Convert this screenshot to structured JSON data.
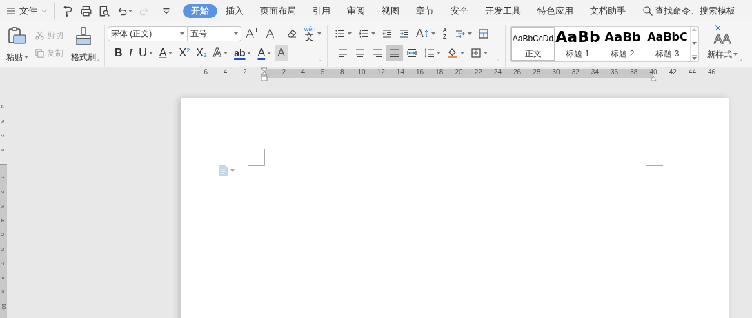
{
  "menu": {
    "label": "文件"
  },
  "quick_access": [
    {
      "kind": "hook",
      "disabled": false
    },
    {
      "kind": "print",
      "disabled": false
    },
    {
      "kind": "preview",
      "disabled": false
    },
    {
      "kind": "undo",
      "disabled": false
    },
    {
      "kind": "redo",
      "disabled": true
    },
    {
      "kind": "customize",
      "disabled": false
    }
  ],
  "tabs": [
    {
      "label": "开始",
      "selected": true
    },
    {
      "label": "插入",
      "selected": false
    },
    {
      "label": "页面布局",
      "selected": false
    },
    {
      "label": "引用",
      "selected": false
    },
    {
      "label": "审阅",
      "selected": false
    },
    {
      "label": "视图",
      "selected": false
    },
    {
      "label": "章节",
      "selected": false
    },
    {
      "label": "安全",
      "selected": false
    },
    {
      "label": "开发工具",
      "selected": false
    },
    {
      "label": "特色应用",
      "selected": false
    },
    {
      "label": "文档助手",
      "selected": false
    }
  ],
  "search": {
    "placeholder": "查找命令、搜索模板"
  },
  "clipboard": {
    "paste": {
      "label": "粘贴"
    },
    "cut": {
      "label": "剪切",
      "disabled": true
    },
    "copy": {
      "label": "复制",
      "disabled": true
    },
    "format_painter": {
      "label": "格式刷"
    }
  },
  "font": {
    "family": "宋体 (正文)",
    "size": "五号"
  },
  "font_tools_row1": [
    {
      "kind": "grow",
      "glyph": "A",
      "dropdown": false
    },
    {
      "kind": "shrink",
      "glyph": "A",
      "dropdown": false
    },
    {
      "kind": "clear",
      "dropdown": false
    },
    {
      "kind": "phonetic",
      "glyph": "文",
      "ruby": "wén",
      "dropdown": true
    }
  ],
  "font_tools_row2": [
    {
      "kind": "bold",
      "glyph": "B",
      "dropdown": false
    },
    {
      "kind": "italic",
      "glyph": "I",
      "dropdown": false
    },
    {
      "kind": "underline",
      "glyph": "U",
      "dropdown": true
    },
    {
      "kind": "strikethrough",
      "glyph": "A",
      "dropdown": true
    },
    {
      "kind": "superscript",
      "glyph": "X",
      "sub": "2",
      "dropdown": false
    },
    {
      "kind": "subscript",
      "glyph": "X",
      "sub": "2",
      "dropdown": false
    },
    {
      "kind": "effect",
      "glyph": "A",
      "dropdown": true
    },
    {
      "kind": "highlight",
      "glyph": "ab",
      "dropdown": true
    },
    {
      "kind": "color",
      "glyph": "A",
      "dropdown": true
    },
    {
      "kind": "shading",
      "glyph": "A",
      "dropdown": false
    }
  ],
  "paragraph_tools_row1": [
    {
      "kind": "bullets",
      "dropdown": true
    },
    {
      "kind": "numbering",
      "dropdown": true
    },
    {
      "kind": "outdent",
      "dropdown": false
    },
    {
      "kind": "indent",
      "dropdown": false
    },
    {
      "kind": "layout",
      "glyph": "A",
      "dropdown": true
    },
    {
      "kind": "sort",
      "glyph": "AZ",
      "dropdown": false
    },
    {
      "kind": "spacing",
      "dropdown": true
    },
    {
      "kind": "table",
      "dropdown": false
    }
  ],
  "paragraph_alignment": [
    {
      "kind": "left",
      "selected": false
    },
    {
      "kind": "center",
      "selected": false
    },
    {
      "kind": "right",
      "selected": false
    },
    {
      "kind": "justify",
      "selected": true
    },
    {
      "kind": "distributed",
      "selected": false
    }
  ],
  "paragraph_tools_row2": [
    {
      "kind": "line_spacing",
      "dropdown": true
    },
    {
      "kind": "fill",
      "dropdown": true
    },
    {
      "kind": "borders",
      "dropdown": true
    }
  ],
  "styles": [
    {
      "kind": "normal",
      "preview": "AaBbCcDd",
      "label": "正文",
      "selected": true
    },
    {
      "kind": "heading1",
      "preview": "AaBb",
      "label": "标题 1",
      "selected": false
    },
    {
      "kind": "heading2",
      "preview": "AaBb",
      "label": "标题 2",
      "selected": false
    },
    {
      "kind": "heading3",
      "preview": "AaBbC",
      "label": "标题 3",
      "selected": false
    }
  ],
  "new_style": {
    "label": "新样式",
    "glyph": "AA"
  },
  "ruler": {
    "left_ticks": [
      "6",
      "4",
      "2"
    ],
    "body_ticks": [
      "2",
      "4",
      "6",
      "8",
      "10",
      "12",
      "14",
      "16",
      "18",
      "20",
      "22",
      "24",
      "26",
      "28",
      "30",
      "32",
      "34",
      "36",
      "38"
    ],
    "right_ticks": [
      "40",
      "42",
      "44",
      "46"
    ]
  },
  "vertical_ruler": {
    "top_ticks": [
      "4",
      "3",
      "2",
      "1"
    ],
    "body_ticks": [
      "1",
      "2",
      "3",
      "4",
      "5",
      "6",
      "7",
      "8",
      "9",
      "10"
    ]
  }
}
